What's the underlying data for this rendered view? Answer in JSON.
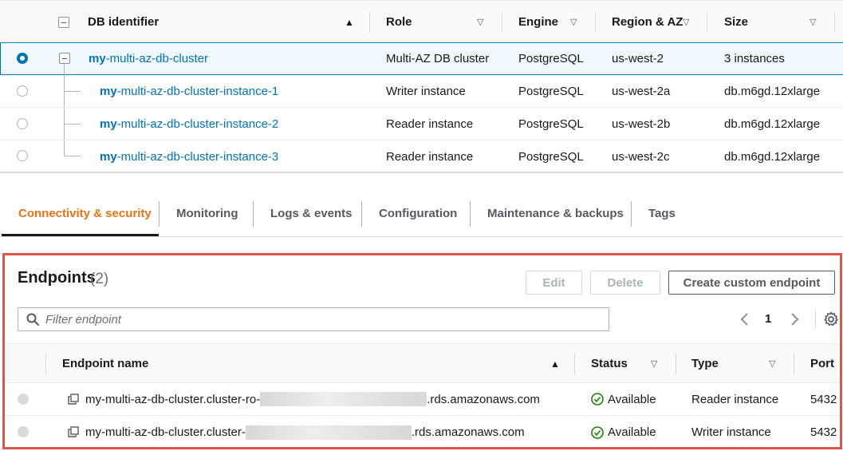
{
  "db_table": {
    "columns": {
      "identifier": "DB identifier",
      "role": "Role",
      "engine": "Engine",
      "region": "Region & AZ",
      "size": "Size"
    },
    "cluster": {
      "prefix": "my",
      "rest": "-multi-az-db-cluster",
      "role": "Multi-AZ DB cluster",
      "engine": "PostgreSQL",
      "region": "us-west-2",
      "size": "3 instances"
    },
    "instances": [
      {
        "prefix": "my",
        "rest": "-multi-az-db-cluster-instance-1",
        "role": "Writer instance",
        "engine": "PostgreSQL",
        "region": "us-west-2a",
        "size": "db.m6gd.12xlarge"
      },
      {
        "prefix": "my",
        "rest": "-multi-az-db-cluster-instance-2",
        "role": "Reader instance",
        "engine": "PostgreSQL",
        "region": "us-west-2b",
        "size": "db.m6gd.12xlarge"
      },
      {
        "prefix": "my",
        "rest": "-multi-az-db-cluster-instance-3",
        "role": "Reader instance",
        "engine": "PostgreSQL",
        "region": "us-west-2c",
        "size": "db.m6gd.12xlarge"
      }
    ]
  },
  "tabs": [
    {
      "label": "Connectivity & security",
      "active": true
    },
    {
      "label": "Monitoring"
    },
    {
      "label": "Logs & events"
    },
    {
      "label": "Configuration"
    },
    {
      "label": "Maintenance & backups"
    },
    {
      "label": "Tags"
    }
  ],
  "endpoints": {
    "title": "Endpoints",
    "count": "(2)",
    "edit_label": "Edit",
    "delete_label": "Delete",
    "create_label": "Create custom endpoint",
    "filter_placeholder": "Filter endpoint",
    "page": "1",
    "columns": {
      "name": "Endpoint name",
      "status": "Status",
      "type": "Type",
      "port": "Port"
    },
    "rows": [
      {
        "name_start": "my-multi-az-db-cluster.cluster-ro-",
        "name_end": ".rds.amazonaws.com",
        "status": "Available",
        "type": "Reader instance",
        "port": "5432"
      },
      {
        "name_start": "my-multi-az-db-cluster.cluster-",
        "name_end": ".rds.amazonaws.com",
        "status": "Available",
        "type": "Writer instance",
        "port": "5432"
      }
    ]
  },
  "colors": {
    "link": "#0073bb",
    "active_tab": "#ec7211",
    "available": "#1d8102",
    "highlight_border": "#e0554a"
  }
}
